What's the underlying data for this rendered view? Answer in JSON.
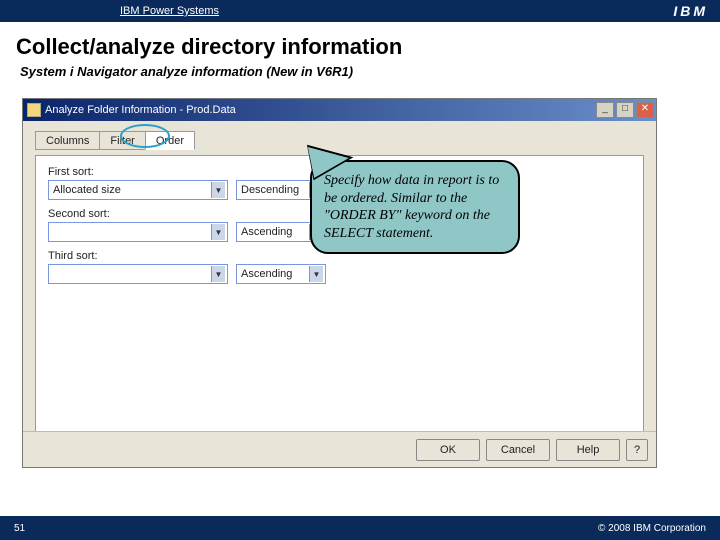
{
  "header": {
    "title": "IBM Power Systems",
    "logo": "IBM"
  },
  "slide": {
    "title": "Collect/analyze directory information",
    "subtitle": "System i Navigator analyze information (New in V6R1)",
    "page": "51",
    "copyright": "© 2008 IBM Corporation"
  },
  "dialog": {
    "title": "Analyze Folder Information - Prod.Data",
    "tabs": [
      "Columns",
      "Filter",
      "Order"
    ],
    "active_tab": 2,
    "sorts": [
      {
        "label": "First sort:",
        "column": "Allocated size",
        "direction": "Descending"
      },
      {
        "label": "Second sort:",
        "column": "",
        "direction": "Ascending"
      },
      {
        "label": "Third sort:",
        "column": "",
        "direction": "Ascending"
      }
    ],
    "buttons": {
      "ok": "OK",
      "cancel": "Cancel",
      "help": "Help",
      "help_icon": "?"
    }
  },
  "callout": {
    "text": "Specify how data in report is to be ordered.  Similar to the \"ORDER BY\" keyword on the SELECT statement."
  }
}
